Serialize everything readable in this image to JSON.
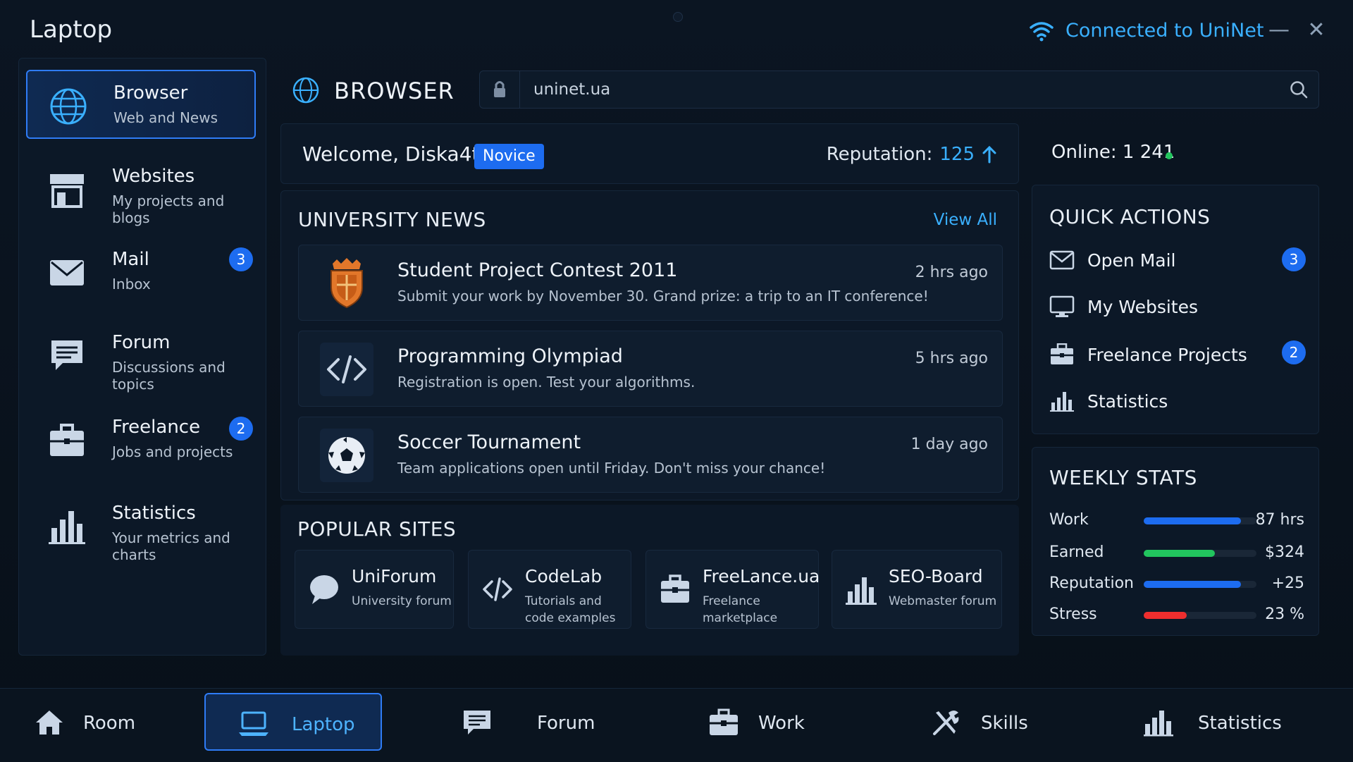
{
  "window": {
    "title": "Laptop",
    "network": "Connected to UniNet",
    "minimize": "—",
    "close": "✕"
  },
  "colors": {
    "accent": "#1d6cf0",
    "link": "#3ab0ff",
    "online": "#22c55e",
    "earned": "#22c55e",
    "stress": "#ef2e2e"
  },
  "sidebar": {
    "items": [
      {
        "title": "Browser",
        "subtitle": "Web and News",
        "icon": "globe-icon"
      },
      {
        "title": "Websites",
        "subtitle": "My projects and blogs",
        "icon": "storefront-icon"
      },
      {
        "title": "Mail",
        "subtitle": "Inbox",
        "icon": "envelope-icon",
        "badge": "3"
      },
      {
        "title": "Forum",
        "subtitle": "Discussions and topics",
        "icon": "chat-icon"
      },
      {
        "title": "Freelance",
        "subtitle": "Jobs and projects",
        "icon": "briefcase-icon",
        "badge": "2"
      },
      {
        "title": "Statistics",
        "subtitle": "Your metrics and charts",
        "icon": "bar-chart-icon"
      }
    ]
  },
  "browser": {
    "title": "BROWSER",
    "url": "uninet.ua"
  },
  "welcome": {
    "text": "Welcome, Diska4t",
    "rank": "Novice",
    "reputation_label": "Reputation:",
    "reputation_value": "125"
  },
  "online": {
    "text": "Online: 1 241"
  },
  "news": {
    "title": "UNIVERSITY NEWS",
    "view_all": "View All",
    "items": [
      {
        "title": "Student Project Contest 2011",
        "desc": "Submit your work by November 30. Grand prize: a trip to an IT conference!",
        "time": "2 hrs ago",
        "icon": "crest-icon"
      },
      {
        "title": "Programming Olympiad",
        "desc": "Registration is open. Test your algorithms.",
        "time": "5 hrs ago",
        "icon": "code-icon"
      },
      {
        "title": "Soccer Tournament",
        "desc": "Team applications open until Friday. Don't miss your chance!",
        "time": "1 day ago",
        "icon": "soccer-ball-icon"
      }
    ]
  },
  "sites": {
    "title": "POPULAR SITES",
    "items": [
      {
        "name": "UniForum",
        "desc": "University forum",
        "icon": "speech-bubble-icon"
      },
      {
        "name": "CodeLab",
        "desc": "Tutorials and code examples",
        "icon": "code-icon"
      },
      {
        "name": "FreeLance.ua",
        "desc": "Freelance marketplace",
        "icon": "briefcase-icon"
      },
      {
        "name": "SEO-Board",
        "desc": "Webmaster forum",
        "icon": "bar-chart-icon"
      }
    ]
  },
  "quick_actions": {
    "title": "QUICK ACTIONS",
    "items": [
      {
        "label": "Open Mail",
        "icon": "envelope-icon",
        "badge": "3"
      },
      {
        "label": "My Websites",
        "icon": "monitor-icon"
      },
      {
        "label": "Freelance Projects",
        "icon": "briefcase-icon",
        "badge": "2"
      },
      {
        "label": "Statistics",
        "icon": "bar-chart-icon"
      }
    ]
  },
  "weekly_stats": {
    "title": "WEEKLY STATS",
    "rows": [
      {
        "label": "Work",
        "value": "87 hrs",
        "level": 0.86,
        "color": "#1d6cf0"
      },
      {
        "label": "Earned",
        "value": "$324",
        "level": 0.63,
        "color": "#22c55e"
      },
      {
        "label": "Reputation",
        "value": "+25",
        "level": 0.86,
        "color": "#1d6cf0"
      },
      {
        "label": "Stress",
        "value": "23 %",
        "level": 0.38,
        "color": "#ef2e2e"
      }
    ]
  },
  "bottom_nav": {
    "items": [
      {
        "label": "Room",
        "icon": "home-icon"
      },
      {
        "label": "Laptop",
        "icon": "laptop-icon",
        "active": true
      },
      {
        "label": "Forum",
        "icon": "chat-icon"
      },
      {
        "label": "Work",
        "icon": "briefcase-icon"
      },
      {
        "label": "Skills",
        "icon": "tools-icon"
      },
      {
        "label": "Statistics",
        "icon": "bar-chart-icon"
      }
    ]
  }
}
